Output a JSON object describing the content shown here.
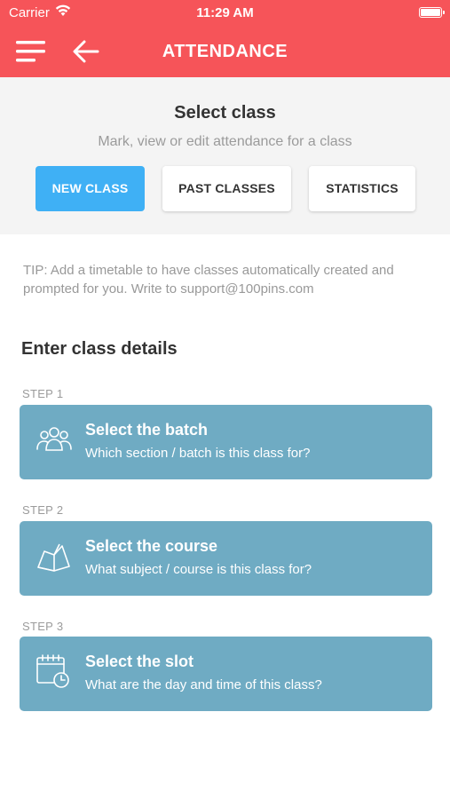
{
  "status_bar": {
    "carrier": "Carrier",
    "time": "11:29 AM"
  },
  "header": {
    "title": "ATTENDANCE",
    "menu_icon": "hamburger-icon",
    "back_icon": "arrow-left-icon"
  },
  "select_panel": {
    "title": "Select class",
    "subtitle": "Mark, view or edit attendance for a class",
    "tabs": [
      {
        "label": "NEW CLASS",
        "selected": true
      },
      {
        "label": "PAST CLASSES",
        "selected": false
      },
      {
        "label": "STATISTICS",
        "selected": false
      }
    ]
  },
  "tip": "TIP: Add a timetable to have classes automatically created and prompted for you. Write to support@100pins.com",
  "details": {
    "title": "Enter class details",
    "steps": [
      {
        "step": "STEP 1",
        "title": "Select the batch",
        "subtitle": "Which section / batch is this class for?",
        "icon": "group-icon"
      },
      {
        "step": "STEP 2",
        "title": "Select the course",
        "subtitle": "What subject / course is this class for?",
        "icon": "book-icon"
      },
      {
        "step": "STEP 3",
        "title": "Select the slot",
        "subtitle": "What are the day and time of this class?",
        "icon": "calendar-clock-icon"
      }
    ]
  },
  "colors": {
    "header": "#f65459",
    "primary_tab": "#3fb0f5",
    "card": "#6fabc3"
  }
}
